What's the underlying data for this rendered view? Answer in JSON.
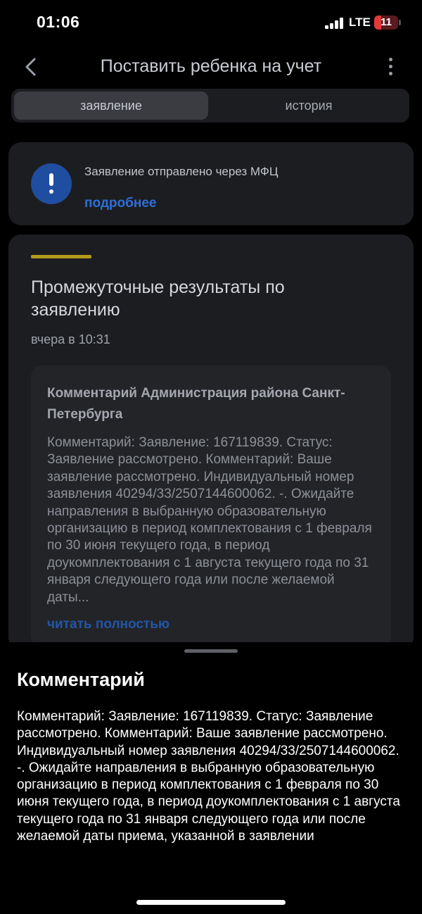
{
  "status_bar": {
    "time": "01:06",
    "network": "LTE",
    "battery": "11"
  },
  "header": {
    "title": "Поставить ребенка на учет",
    "back_icon": "chevron-left-icon",
    "more_icon": "more-vertical-icon"
  },
  "tabs": [
    {
      "label": "заявление",
      "active": true
    },
    {
      "label": "история",
      "active": false
    }
  ],
  "notice": {
    "icon": "exclamation-icon",
    "text": "Заявление отправлено через МФЦ",
    "link": "подробнее"
  },
  "result": {
    "title": "Промежуточные результаты по заявлению",
    "date": "вчера в 10:31",
    "comment": {
      "title": "Комментарий Администрация района Санкт-Петербурга",
      "text": "Комментарий: Заявление: 167119839. Статус: Заявление рассмотрено. Комментарий: Ваше заявление рассмотрено. Индивидуальный номер заявления 40294/33/2507144600062. -. Ожидайте направления в выбранную образовательную организацию в период комплектования с 1 февраля по 30 июня текущего года, в период доукомплектования с 1 августа текущего года по 31 января следующего года или после желаемой даты...",
      "link": "читать полностью"
    }
  },
  "sheet": {
    "title": "Комментарий",
    "text": "Комментарий: Заявление: 167119839. Статус: Заявление рассмотрено. Комментарий: Ваше заявление рассмотрено. Индивидуальный номер заявления 40294/33/2507144600062. -. Ожидайте направления в выбранную образовательную организацию в период комплектования с 1 февраля по 30 июня текущего года, в период доукомплектования с 1 августа текущего года по 31 января следующего года или после желаемой даты приема, указанной в заявлении"
  },
  "colors": {
    "accent_yellow": "#b39a1c",
    "link_blue": "#2f6fd8",
    "icon_blue": "#1f4ea0",
    "card_bg": "#1c1d20"
  }
}
